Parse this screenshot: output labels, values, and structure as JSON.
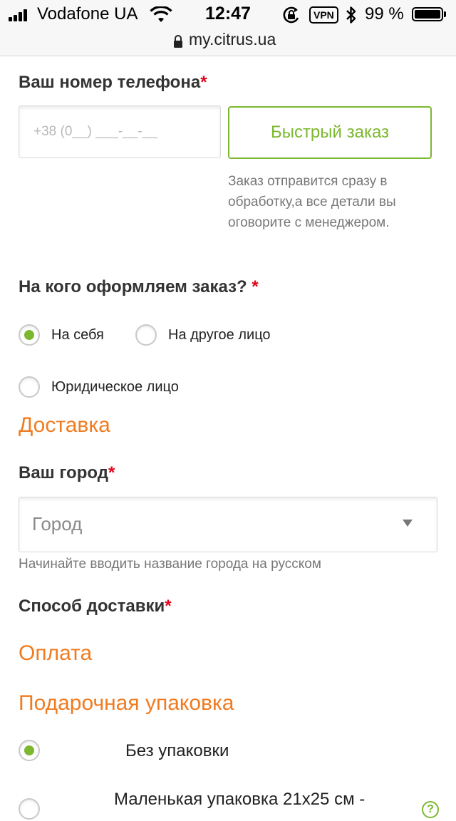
{
  "status_bar": {
    "carrier": "Vodafone UA",
    "time": "12:47",
    "vpn": "VPN",
    "battery_percent": "99 %",
    "battery_level": 0.99,
    "icons": [
      "signal-icon",
      "wifi-icon",
      "rotation-lock-icon",
      "bluetooth-icon",
      "battery-icon"
    ]
  },
  "browser": {
    "url": "my.citrus.ua",
    "icons": [
      "lock-icon"
    ]
  },
  "phone_section": {
    "label": "Ваш номер телефона",
    "required_mark": "*",
    "phone_placeholder": "+38 (0__) ___-__-__",
    "quick_order_button": "Быстрый заказ",
    "quick_order_note": "Заказ отправится сразу в обработку,а все детали вы оговорите с менеджером."
  },
  "recipient_section": {
    "label": "На кого оформляем заказ?",
    "required_mark": " *",
    "options": [
      {
        "label": "На себя",
        "checked": true
      },
      {
        "label": "На другое лицо",
        "checked": false
      },
      {
        "label": "Юридическое лицо",
        "checked": false
      }
    ]
  },
  "delivery_section": {
    "title": "Доставка",
    "city_label": "Ваш город",
    "city_required": "*",
    "city_value": "Город",
    "city_hint": "Начинайте вводить название города на русском",
    "method_label": "Способ доставки",
    "method_required": "*"
  },
  "payment_section": {
    "title": "Оплата"
  },
  "gift_section": {
    "title": "Подарочная упаковка",
    "options": [
      {
        "label": "Без упаковки",
        "checked": true
      },
      {
        "label": "Маленькая упаковка 21x25 см -",
        "checked": false
      }
    ],
    "help_icon": "question-icon",
    "help_glyph": "?"
  },
  "colors": {
    "accent_green": "#7cb82f",
    "section_orange": "#f07c21",
    "required_red": "#e3051b"
  }
}
